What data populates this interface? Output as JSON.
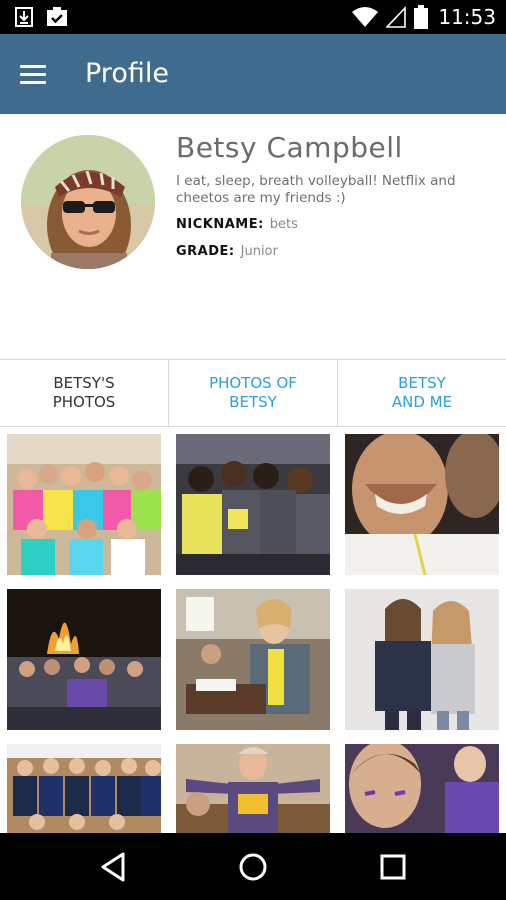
{
  "status_bar": {
    "time": "11:53",
    "left_icons": [
      "download-icon",
      "clipboard-check-icon"
    ],
    "right_icons": [
      "wifi-icon",
      "cell-signal-icon",
      "battery-icon"
    ]
  },
  "app_bar": {
    "title": "Profile",
    "menu_icon": "menu-icon"
  },
  "profile": {
    "name": "Betsy Campbell",
    "bio": "I eat, sleep, breath volleyball! Netflix and cheetos are my friends :)",
    "nickname_label": "NICKNAME:",
    "nickname": "bets",
    "grade_label": "GRADE:",
    "grade": "Junior"
  },
  "tabs": [
    {
      "label": "BETSY'S\nPHOTOS",
      "active": true
    },
    {
      "label": "PHOTOS OF\nBETSY",
      "active": false
    },
    {
      "label": "BETSY\nAND ME",
      "active": false
    }
  ],
  "photos": [
    {
      "name": "photo-group-neon"
    },
    {
      "name": "photo-volleyball-huddle"
    },
    {
      "name": "photo-selfie-friends"
    },
    {
      "name": "photo-bonfire-group"
    },
    {
      "name": "photo-classroom"
    },
    {
      "name": "photo-two-girls"
    },
    {
      "name": "photo-team-medals"
    },
    {
      "name": "photo-man-purple-shirt"
    },
    {
      "name": "photo-fans-crowd"
    }
  ],
  "colors": {
    "app_bar": "#3f6b8e",
    "tab_active": "#333333",
    "tab_inactive": "#2b9fe0"
  },
  "nav_bar": {
    "icons": [
      "back-icon",
      "home-icon",
      "recents-icon"
    ]
  }
}
